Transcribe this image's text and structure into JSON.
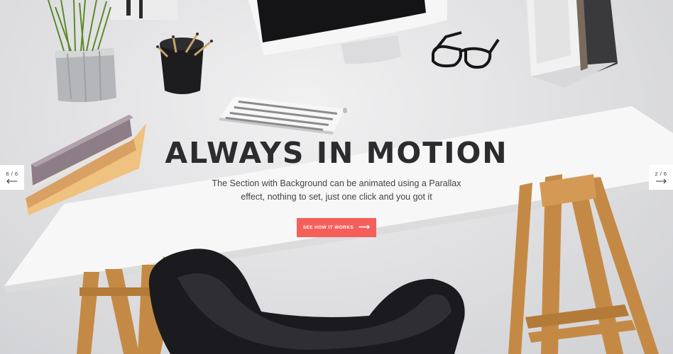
{
  "hero": {
    "headline": "ALWAYS IN MOTION",
    "subtext_line1": "The Section with Background can be animated using a Parallax",
    "subtext_line2": "effect, nothing to set, just one click and you got it",
    "cta_label": "SEE HOW IT WORKS",
    "cta_icon": "arrow-right-icon",
    "cta_color": "#f55f5a"
  },
  "slider": {
    "prev_counter": "6 / 6",
    "next_counter": "2 / 6",
    "prev_icon": "arrow-left-icon",
    "next_icon": "arrow-right-icon"
  }
}
